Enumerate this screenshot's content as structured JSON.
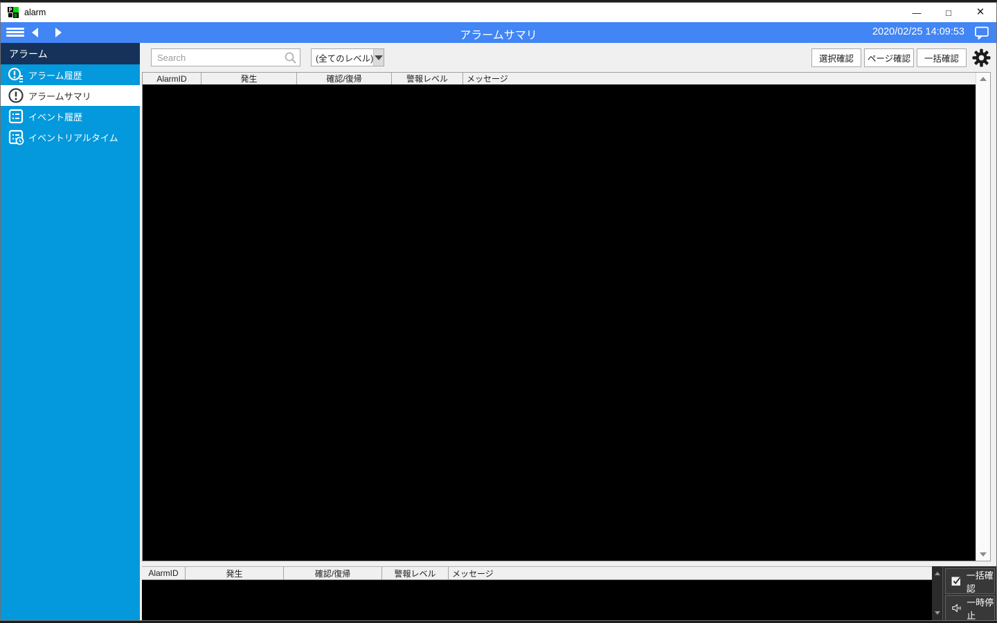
{
  "window": {
    "app_title": "alarm",
    "controls": {
      "minimize_glyph": "—",
      "maximize_glyph": "□",
      "close_glyph": "×"
    }
  },
  "navbar": {
    "title": "アラームサマリ",
    "datetime": "2020/02/25 14:09:53"
  },
  "sidebar": {
    "header": "アラーム",
    "items": [
      {
        "label": "アラーム履歴",
        "icon": "alarm-history-icon",
        "selected": false
      },
      {
        "label": "アラームサマリ",
        "icon": "alarm-summary-icon",
        "selected": true
      },
      {
        "label": "イベント履歴",
        "icon": "event-history-icon",
        "selected": false
      },
      {
        "label": "イベントリアルタイム",
        "icon": "event-realtime-icon",
        "selected": false
      }
    ]
  },
  "toolbar": {
    "search_placeholder": "Search",
    "search_value": "",
    "level_filter_value": "(全てのレベル)",
    "buttons": [
      {
        "label": "選択確認"
      },
      {
        "label": "ページ確認"
      },
      {
        "label": "一括確認"
      }
    ],
    "settings_icon": "gear-icon"
  },
  "main_table": {
    "columns": [
      "AlarmID",
      "発生",
      "確認/復帰",
      "警報レベル",
      "メッセージ"
    ],
    "rows": []
  },
  "bottom_table": {
    "columns": [
      "AlarmID",
      "発生",
      "確認/復帰",
      "警報レベル",
      "メッセージ"
    ],
    "rows": []
  },
  "bottom_actions": [
    {
      "label": "一括確認",
      "icon": "checked-checkbox-icon"
    },
    {
      "label": "一時停止",
      "icon": "speaker-icon"
    }
  ],
  "icons": {
    "app": "app-logo",
    "menu": "hamburger-icon",
    "back": "arrow-left-icon",
    "forward": "arrow-right-icon",
    "chat": "chat-bubble-icon",
    "search": "magnifier-icon",
    "dropdown": "triangle-down-icon",
    "scroll": "triangle-up/down-icons"
  },
  "colors": {
    "navbar_blue": "#4285f4",
    "sidebar_cyan": "#0399dc",
    "sidebar_header_navy": "#16325a",
    "selected_item_bg": "#ffffff",
    "toolbar_gray": "#f0f0f0",
    "table_body_black": "#000000",
    "bottom_panel_dark": "#323232"
  }
}
